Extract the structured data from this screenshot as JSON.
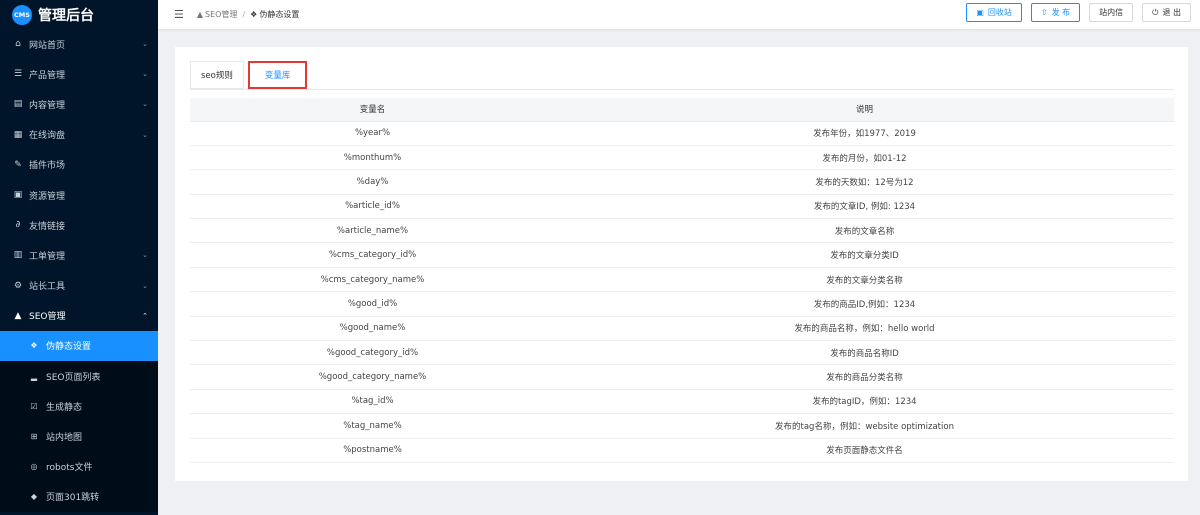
{
  "app": {
    "logo_badge": "CMS",
    "title": "管理后台"
  },
  "colors": {
    "sidebar_bg": "#001529",
    "accent": "#1890ff",
    "highlight_border": "#e53935"
  },
  "sidebar": {
    "items": [
      {
        "label": "网站首页",
        "icon": "home-icon",
        "glyph": "⌂",
        "arrow": "⌄"
      },
      {
        "label": "产品管理",
        "icon": "list-icon",
        "glyph": "☰",
        "arrow": "⌄"
      },
      {
        "label": "内容管理",
        "icon": "content-icon",
        "glyph": "▤",
        "arrow": "⌄"
      },
      {
        "label": "在线询盘",
        "icon": "grid-icon",
        "glyph": "▦",
        "arrow": "⌄"
      },
      {
        "label": "插件市场",
        "icon": "pin-icon",
        "glyph": "✎",
        "arrow": ""
      },
      {
        "label": "资源管理",
        "icon": "apps-icon",
        "glyph": "▣",
        "arrow": ""
      },
      {
        "label": "友情链接",
        "icon": "link-icon",
        "glyph": "∂",
        "arrow": ""
      },
      {
        "label": "工单管理",
        "icon": "ticket-icon",
        "glyph": "▥",
        "arrow": "⌄"
      },
      {
        "label": "站长工具",
        "icon": "tools-icon",
        "glyph": "⚙",
        "arrow": "⌄"
      },
      {
        "label": "SEO管理",
        "icon": "warning-icon",
        "glyph": "▲",
        "arrow": "⌃"
      }
    ],
    "sub_items": [
      {
        "label": "伪静态设置",
        "icon": "pseudo-static-icon",
        "glyph": "❖"
      },
      {
        "label": "SEO页面列表",
        "icon": "chart-icon",
        "glyph": "▂"
      },
      {
        "label": "生成静态",
        "icon": "checkbox-icon",
        "glyph": "☑"
      },
      {
        "label": "站内地图",
        "icon": "sitemap-icon",
        "glyph": "⊞"
      },
      {
        "label": "robots文件",
        "icon": "robot-icon",
        "glyph": "◎"
      },
      {
        "label": "页面301跳转",
        "icon": "tag-icon",
        "glyph": "◆"
      }
    ]
  },
  "header": {
    "breadcrumb": {
      "parent": "SEO管理",
      "separator": "/",
      "current": "伪静态设置"
    },
    "buttons": {
      "recycle": "回收站",
      "publish": "发 布",
      "message": "站内信",
      "logout": "退 出"
    }
  },
  "tabs": {
    "seo_rules": "seo规则",
    "var_library": "变量库"
  },
  "table": {
    "headers": {
      "name": "变量名",
      "desc": "说明"
    },
    "rows": [
      {
        "name": "%year%",
        "desc": "发布年份，如1977、2019"
      },
      {
        "name": "%monthum%",
        "desc": "发布的月份，如01-12"
      },
      {
        "name": "%day%",
        "desc": "发布的天数如：12号为12"
      },
      {
        "name": "%article_id%",
        "desc": "发布的文章ID, 例如: 1234"
      },
      {
        "name": "%article_name%",
        "desc": "发布的文章名称"
      },
      {
        "name": "%cms_category_id%",
        "desc": "发布的文章分类ID"
      },
      {
        "name": "%cms_category_name%",
        "desc": "发布的文章分类名称"
      },
      {
        "name": "%good_id%",
        "desc": "发布的商品ID,例如：1234"
      },
      {
        "name": "%good_name%",
        "desc": "发布的商品名称，例如：hello world"
      },
      {
        "name": "%good_category_id%",
        "desc": "发布的商品名称ID"
      },
      {
        "name": "%good_category_name%",
        "desc": "发布的商品分类名称"
      },
      {
        "name": "%tag_id%",
        "desc": "发布的tagID，例如：1234"
      },
      {
        "name": "%tag_name%",
        "desc": "发布的tag名称，例如：website optimization"
      },
      {
        "name": "%postname%",
        "desc": "发布页面静态文件名"
      }
    ]
  }
}
